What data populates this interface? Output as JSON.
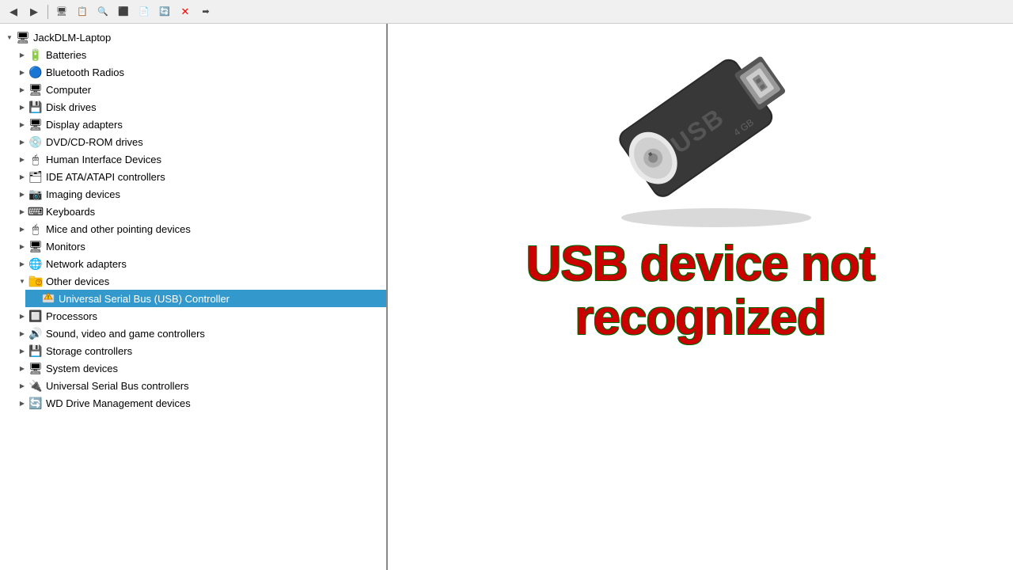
{
  "toolbar": {
    "buttons": [
      "◀",
      "▶",
      "⬛",
      "⬛",
      "⬛",
      "⬛",
      "⬛",
      "⬛",
      "✕",
      "⬛"
    ]
  },
  "tree": {
    "root_label": "JackDLM-Laptop",
    "items": [
      {
        "id": "batteries",
        "label": "Batteries",
        "indent": 1,
        "expand": "collapsed",
        "icon": "🔋"
      },
      {
        "id": "bluetooth",
        "label": "Bluetooth Radios",
        "indent": 1,
        "expand": "collapsed",
        "icon": "🔵"
      },
      {
        "id": "computer",
        "label": "Computer",
        "indent": 1,
        "expand": "collapsed",
        "icon": "💻"
      },
      {
        "id": "disk",
        "label": "Disk drives",
        "indent": 1,
        "expand": "collapsed",
        "icon": "💾"
      },
      {
        "id": "display",
        "label": "Display adapters",
        "indent": 1,
        "expand": "collapsed",
        "icon": "🖥"
      },
      {
        "id": "dvd",
        "label": "DVD/CD-ROM drives",
        "indent": 1,
        "expand": "collapsed",
        "icon": "💿"
      },
      {
        "id": "hid",
        "label": "Human Interface Devices",
        "indent": 1,
        "expand": "collapsed",
        "icon": "⌨"
      },
      {
        "id": "ide",
        "label": "IDE ATA/ATAPI controllers",
        "indent": 1,
        "expand": "collapsed",
        "icon": "🗂"
      },
      {
        "id": "imaging",
        "label": "Imaging devices",
        "indent": 1,
        "expand": "collapsed",
        "icon": "📷"
      },
      {
        "id": "keyboards",
        "label": "Keyboards",
        "indent": 1,
        "expand": "collapsed",
        "icon": "⌨"
      },
      {
        "id": "mice",
        "label": "Mice and other pointing devices",
        "indent": 1,
        "expand": "collapsed",
        "icon": "🖱"
      },
      {
        "id": "monitors",
        "label": "Monitors",
        "indent": 1,
        "expand": "collapsed",
        "icon": "🖥"
      },
      {
        "id": "network",
        "label": "Network adapters",
        "indent": 1,
        "expand": "collapsed",
        "icon": "🌐"
      },
      {
        "id": "other",
        "label": "Other devices",
        "indent": 1,
        "expand": "expanded",
        "icon": "❓",
        "warn": true
      },
      {
        "id": "usb-ctrl",
        "label": "Universal Serial Bus (USB) Controller",
        "indent": 2,
        "expand": "none",
        "icon": "⚠",
        "selected": true
      },
      {
        "id": "processors",
        "label": "Processors",
        "indent": 1,
        "expand": "collapsed",
        "icon": "🔲"
      },
      {
        "id": "sound",
        "label": "Sound, video and game controllers",
        "indent": 1,
        "expand": "collapsed",
        "icon": "🔊"
      },
      {
        "id": "storage",
        "label": "Storage controllers",
        "indent": 1,
        "expand": "collapsed",
        "icon": "💾"
      },
      {
        "id": "system",
        "label": "System devices",
        "indent": 1,
        "expand": "collapsed",
        "icon": "🖥"
      },
      {
        "id": "usb",
        "label": "Universal Serial Bus controllers",
        "indent": 1,
        "expand": "collapsed",
        "icon": "🔌"
      },
      {
        "id": "wd",
        "label": "WD Drive Management devices",
        "indent": 1,
        "expand": "collapsed",
        "icon": "🔄"
      }
    ]
  },
  "error": {
    "line1": "USB device not",
    "line2": "recognized"
  }
}
